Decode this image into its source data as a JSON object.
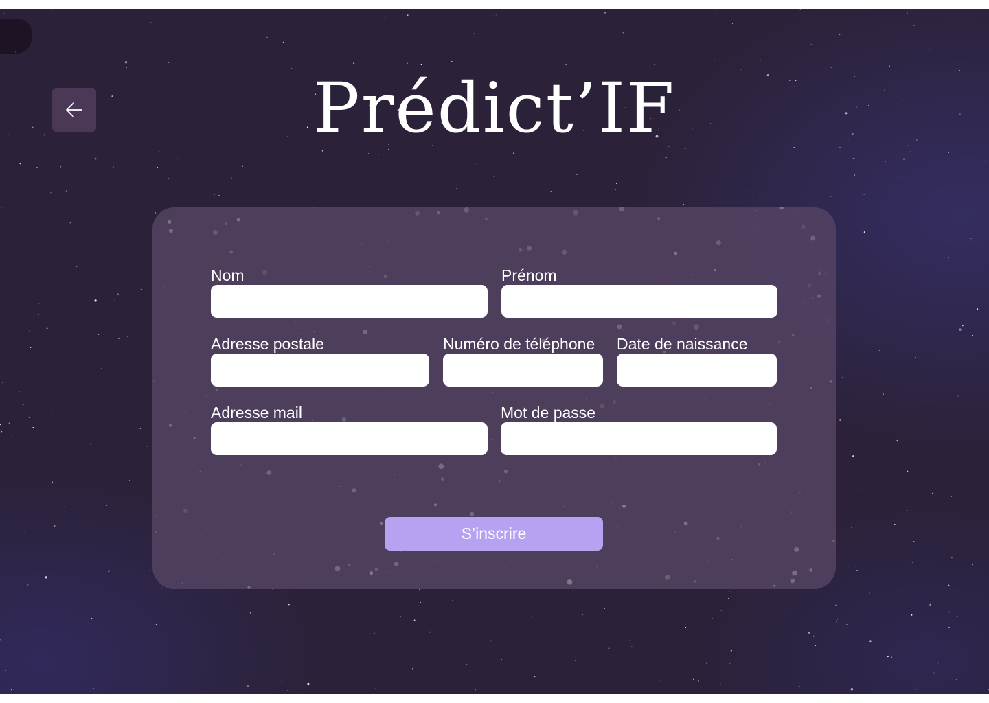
{
  "app": {
    "title": "Prédict’IF"
  },
  "navigation": {
    "back_icon": "arrow-left-icon"
  },
  "form": {
    "fields": {
      "nom": {
        "label": "Nom",
        "value": ""
      },
      "prenom": {
        "label": "Prénom",
        "value": ""
      },
      "adresse_postale": {
        "label": "Adresse postale",
        "value": ""
      },
      "telephone": {
        "label": "Numéro de téléphone",
        "value": ""
      },
      "date_naissance": {
        "label": "Date de naissance",
        "value": ""
      },
      "email": {
        "label": "Adresse mail",
        "value": ""
      },
      "mot_de_passe": {
        "label": "Mot de passe",
        "value": ""
      }
    },
    "submit_label": "S’inscrire"
  },
  "colors": {
    "background": "#2b2138",
    "card": "#564464",
    "accent": "#b6a2f0",
    "back_button": "#4a3856"
  }
}
